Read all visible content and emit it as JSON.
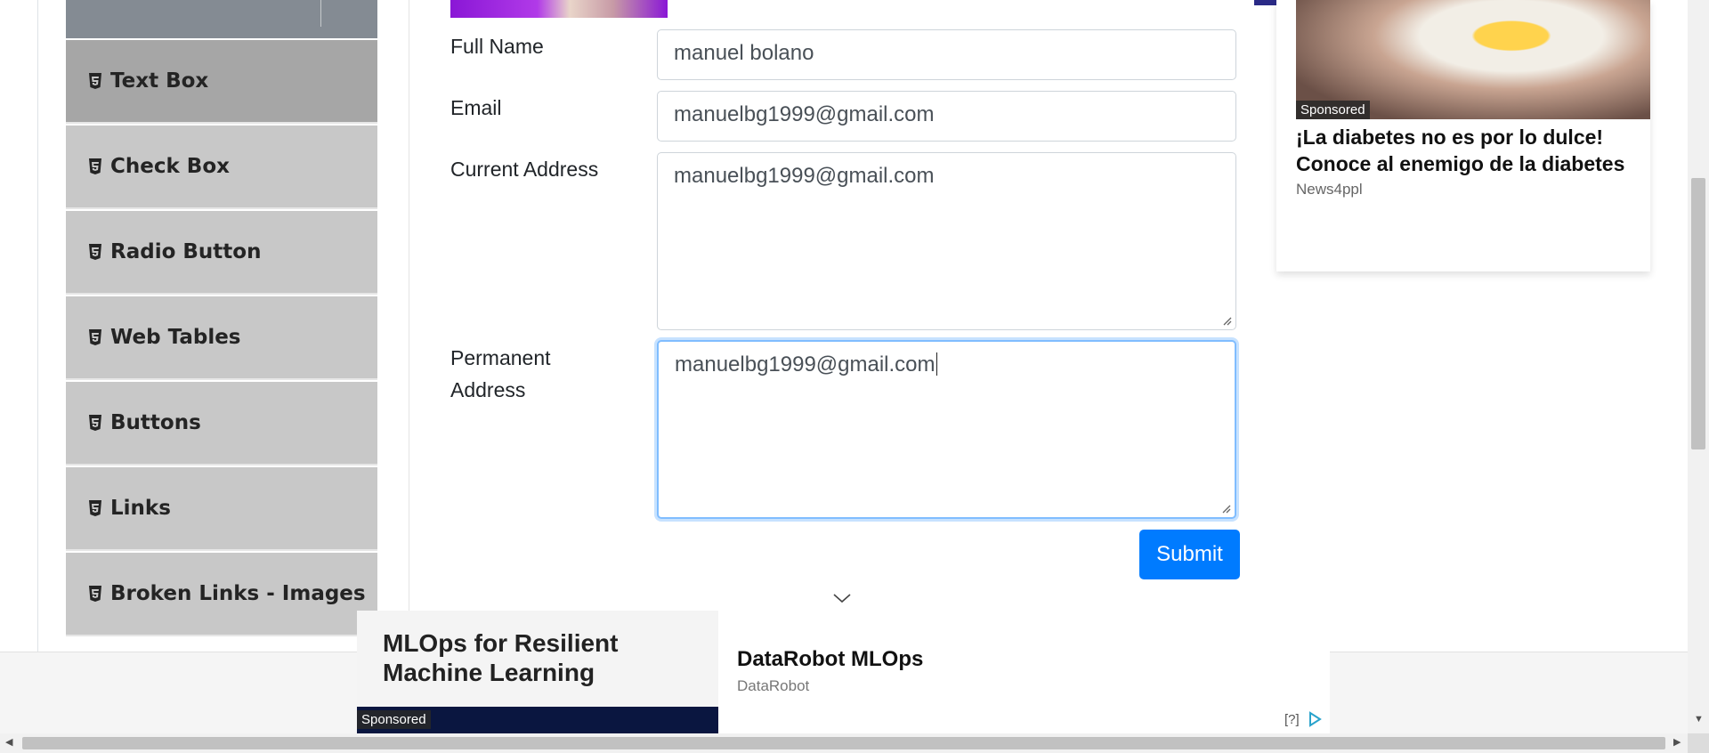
{
  "sidebar": {
    "items": [
      {
        "label": "Text Box",
        "active": true
      },
      {
        "label": "Check Box",
        "active": false
      },
      {
        "label": "Radio Button",
        "active": false
      },
      {
        "label": "Web Tables",
        "active": false
      },
      {
        "label": "Buttons",
        "active": false
      },
      {
        "label": "Links",
        "active": false
      },
      {
        "label": "Broken Links - Images",
        "active": false
      }
    ],
    "item_icon": "html5-icon"
  },
  "form": {
    "full_name": {
      "label": "Full Name",
      "value": "manuel bolano"
    },
    "email": {
      "label": "Email",
      "value": "manuelbg1999@gmail.com"
    },
    "current_address": {
      "label": "Current Address",
      "value": "manuelbg1999@gmail.com"
    },
    "permanent_address": {
      "label_line1": "Permanent",
      "label_line2": "Address",
      "value": "manuelbg1999@gmail.com",
      "focused": true
    },
    "submit_label": "Submit"
  },
  "right_ad": {
    "sponsored": "Sponsored",
    "title": "¡La diabetes no es por lo dulce! Conoce al enemigo de la diabetes",
    "source": "News4ppl",
    "info": "[?]"
  },
  "bottom_ad": {
    "headline": "MLOps for Resilient Machine Learning",
    "sponsored": "Sponsored",
    "title": "DataRobot MLOps",
    "source": "DataRobot",
    "info": "[?]"
  },
  "colors": {
    "submit": "#007bff",
    "sidebar_item": "#c8c8c8",
    "sidebar_item_active": "#a6a6a6",
    "focus_border": "#80bdff"
  }
}
